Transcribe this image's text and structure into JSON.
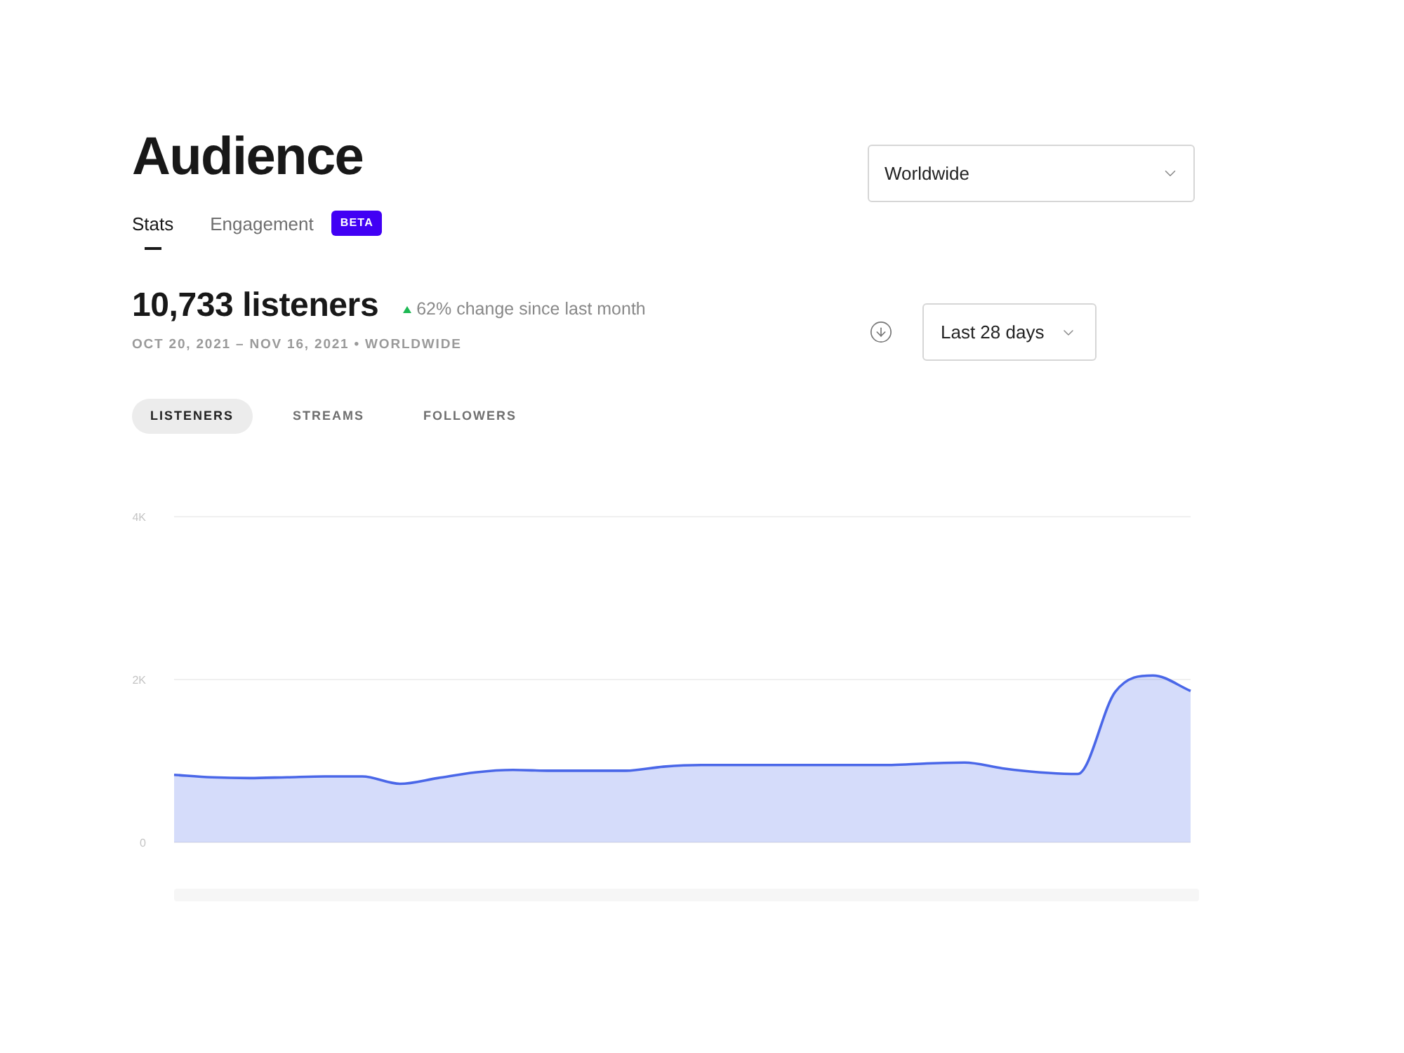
{
  "page": {
    "title": "Audience"
  },
  "tabs": [
    {
      "label": "Stats",
      "selected": true
    },
    {
      "label": "Engagement",
      "selected": false,
      "badge": "BETA"
    }
  ],
  "region_select": {
    "value": "Worldwide"
  },
  "summary": {
    "count": "10,733 listeners",
    "change": "62% change since last month",
    "date_range": "OCT 20, 2021 – NOV 16, 2021 • WORLDWIDE"
  },
  "period_select": {
    "value": "Last 28 days"
  },
  "metric_tabs": [
    {
      "label": "LISTENERS",
      "selected": true
    },
    {
      "label": "STREAMS",
      "selected": false
    },
    {
      "label": "FOLLOWERS",
      "selected": false
    }
  ],
  "chart": {
    "chart_data": {
      "type": "area",
      "tick_labels": "y",
      "grid": true,
      "ylim": [
        0,
        4000
      ],
      "yticks": [
        {
          "value": 0,
          "label": "0"
        },
        {
          "value": 2000,
          "label": "2K"
        },
        {
          "value": 4000,
          "label": "4K"
        }
      ],
      "color": "#4a67e8",
      "values": [
        830,
        800,
        790,
        800,
        810,
        810,
        720,
        790,
        860,
        890,
        880,
        880,
        880,
        930,
        950,
        950,
        950,
        950,
        950,
        950,
        970,
        980,
        910,
        860,
        840,
        1850,
        2050,
        1860
      ]
    }
  }
}
